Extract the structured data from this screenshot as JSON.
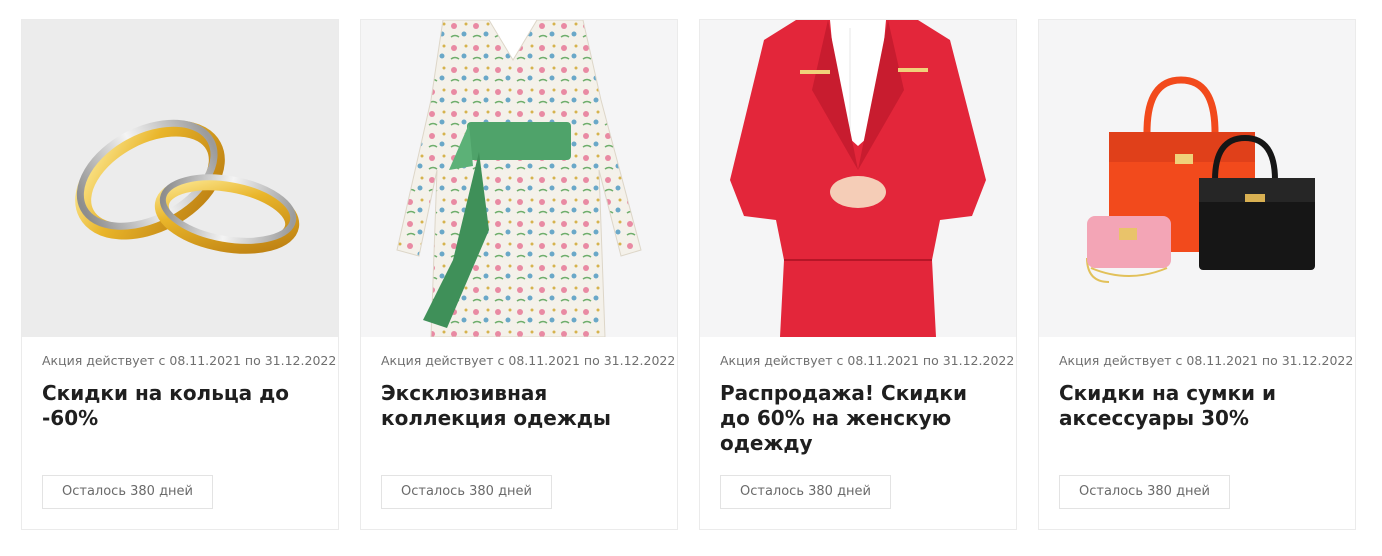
{
  "promos": [
    {
      "image_icon": "rings-image",
      "date": "Акция действует с 08.11.2021 по 31.12.2022",
      "title": "Скидки на кольца до -60%",
      "remaining": "Осталось 380 дней"
    },
    {
      "image_icon": "floral-dress-image",
      "date": "Акция действует с 08.11.2021 по 31.12.2022",
      "title": "Эксклюзивная коллекция одежды",
      "remaining": "Осталось 380 дней"
    },
    {
      "image_icon": "red-suit-image",
      "date": "Акция действует с 08.11.2021 по 31.12.2022",
      "title": "Распродажа! Скидки до 60% на женскую одежду",
      "remaining": "Осталось 380 дней"
    },
    {
      "image_icon": "handbags-image",
      "date": "Акция действует с 08.11.2021 по 31.12.2022",
      "title": "Скидки на сумки и аксессуары 30%",
      "remaining": "Осталось 380 дней"
    }
  ],
  "colors": {
    "gold": "#e9b52a",
    "dress_sash": "#4fa36a",
    "suit_red": "#e3263a",
    "bag_orange": "#f24a1c",
    "bag_black": "#161616",
    "bag_pink": "#f3a5b6"
  }
}
